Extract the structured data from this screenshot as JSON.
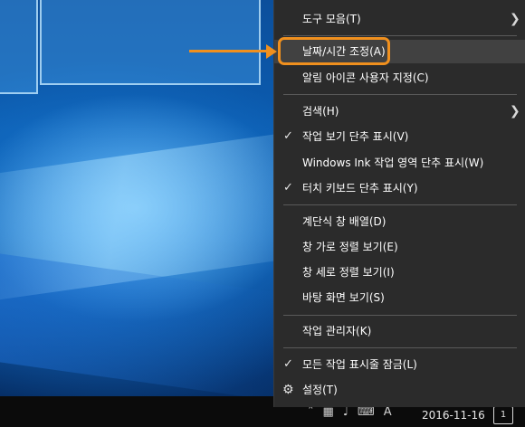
{
  "context_menu": {
    "toolbars": "도구 모음(T)",
    "adjust_datetime": "날짜/시간 조정(A)",
    "customize_notification_icons": "알림 아이콘 사용자 지정(C)",
    "search": "검색(H)",
    "show_task_view_button": "작업 보기 단추 표시(V)",
    "show_ink_workspace_button": "Windows Ink 작업 영역 단추 표시(W)",
    "show_touch_keyboard_button": "터치 키보드 단추 표시(Y)",
    "cascade_windows": "계단식 창 배열(D)",
    "show_windows_stacked": "창 가로 정렬 보기(E)",
    "show_windows_side_by_side": "창 세로 정렬 보기(I)",
    "show_desktop": "바탕 화면 보기(S)",
    "task_manager": "작업 관리자(K)",
    "lock_all_taskbars": "모든 작업 표시줄 잠금(L)",
    "settings": "설정(T)"
  },
  "taskbar": {
    "clock_date": "2016-11-16",
    "input_indicator": "A",
    "notification_count": "1"
  },
  "annotation": {
    "highlight_color": "#f0901e"
  }
}
